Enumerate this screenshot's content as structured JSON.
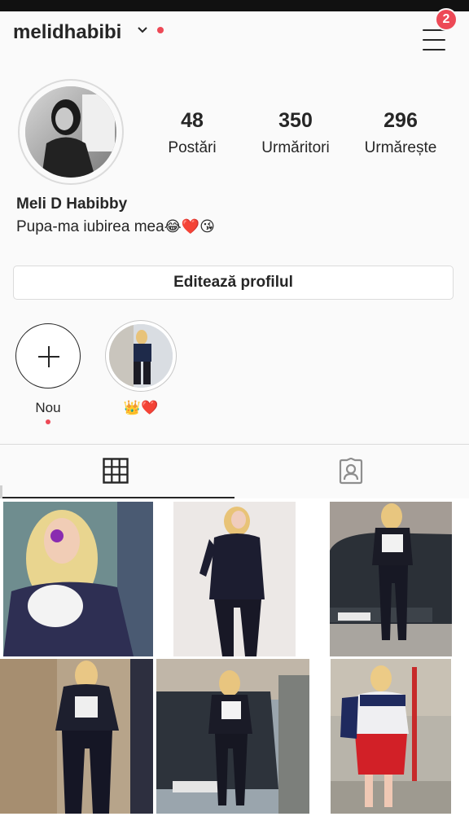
{
  "header": {
    "username": "melidhabibi",
    "notification_count": "2"
  },
  "profile": {
    "stats": [
      {
        "value": "48",
        "label": "Postări"
      },
      {
        "value": "350",
        "label": "Urmăritori"
      },
      {
        "value": "296",
        "label": "Urmărește"
      }
    ],
    "full_name": "Meli D Habibby",
    "bio_text": "Pupa-ma iubirea mea",
    "bio_emoji": "😂❤️😘",
    "edit_button": "Editează profilul"
  },
  "highlights": [
    {
      "label": "Nou"
    },
    {
      "label": "👑❤️"
    }
  ],
  "tabs": [
    {
      "icon": "grid-icon",
      "active": true
    },
    {
      "icon": "tagged-person-icon",
      "active": false
    }
  ],
  "colors": {
    "accent_red": "#ed4956",
    "text": "#262626",
    "border": "#dbdbdb",
    "background": "#fafafa"
  },
  "posts": [
    {
      "description": "photo-1"
    },
    {
      "description": "photo-2"
    },
    {
      "description": "photo-3"
    },
    {
      "description": "photo-4"
    },
    {
      "description": "photo-5"
    },
    {
      "description": "photo-6"
    }
  ]
}
